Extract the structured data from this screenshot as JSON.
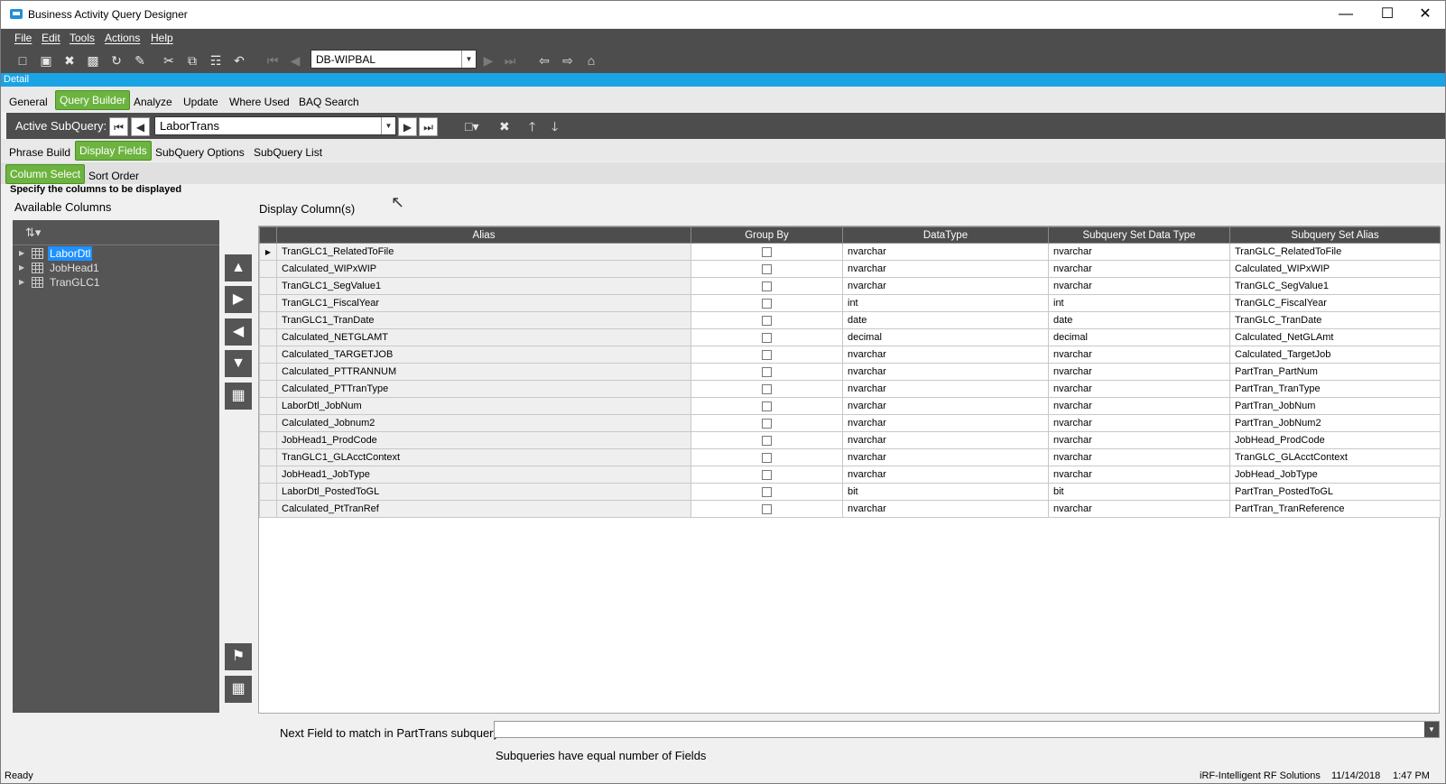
{
  "window": {
    "title": "Business Activity Query Designer"
  },
  "menu": [
    "File",
    "Edit",
    "Tools",
    "Actions",
    "Help"
  ],
  "toolbar": {
    "query_id": "DB-WIPBAL"
  },
  "detail_label": "Detail",
  "main_tabs": [
    "General",
    "Query Builder",
    "Analyze",
    "Update",
    "Where Used",
    "BAQ Search"
  ],
  "subquery": {
    "label": "Active SubQuery:",
    "value": "LaborTrans"
  },
  "sub_tabs": [
    "Phrase Build",
    "Display Fields",
    "SubQuery Options",
    "SubQuery List"
  ],
  "inner_tabs": [
    "Column Select",
    "Sort Order"
  ],
  "hint": "Specify the columns to be displayed",
  "available_label": "Available Columns",
  "display_label": "Display Column(s)",
  "tree": [
    "LaborDtl",
    "JobHead1",
    "TranGLC1"
  ],
  "grid": {
    "columns": [
      "Alias",
      "Group By",
      "DataType",
      "Subquery Set Data Type",
      "Subquery Set Alias"
    ],
    "rows": [
      [
        "TranGLC1_RelatedToFile",
        "nvarchar",
        "nvarchar",
        "TranGLC_RelatedToFile"
      ],
      [
        "Calculated_WIPxWIP",
        "nvarchar",
        "nvarchar",
        "Calculated_WIPxWIP"
      ],
      [
        "TranGLC1_SegValue1",
        "nvarchar",
        "nvarchar",
        "TranGLC_SegValue1"
      ],
      [
        "TranGLC1_FiscalYear",
        "int",
        "int",
        "TranGLC_FiscalYear"
      ],
      [
        "TranGLC1_TranDate",
        "date",
        "date",
        "TranGLC_TranDate"
      ],
      [
        "Calculated_NETGLAMT",
        "decimal",
        "decimal",
        "Calculated_NetGLAmt"
      ],
      [
        "Calculated_TARGETJOB",
        "nvarchar",
        "nvarchar",
        "Calculated_TargetJob"
      ],
      [
        "Calculated_PTTRANNUM",
        "nvarchar",
        "nvarchar",
        "PartTran_PartNum"
      ],
      [
        "Calculated_PTTranType",
        "nvarchar",
        "nvarchar",
        "PartTran_TranType"
      ],
      [
        "LaborDtl_JobNum",
        "nvarchar",
        "nvarchar",
        "PartTran_JobNum"
      ],
      [
        "Calculated_Jobnum2",
        "nvarchar",
        "nvarchar",
        "PartTran_JobNum2"
      ],
      [
        "JobHead1_ProdCode",
        "nvarchar",
        "nvarchar",
        "JobHead_ProdCode"
      ],
      [
        "TranGLC1_GLAcctContext",
        "nvarchar",
        "nvarchar",
        "TranGLC_GLAcctContext"
      ],
      [
        "JobHead1_JobType",
        "nvarchar",
        "nvarchar",
        "JobHead_JobType"
      ],
      [
        "LaborDtl_PostedToGL",
        "bit",
        "bit",
        "PartTran_PostedToGL"
      ],
      [
        "Calculated_PtTranRef",
        "nvarchar",
        "nvarchar",
        "PartTran_TranReference"
      ]
    ]
  },
  "next_field_label": "Next Field to match in PartTrans subquery:",
  "equal_msg": "Subqueries have equal number of Fields",
  "status": {
    "left": "Ready",
    "company": "iRF-Intelligent RF Solutions",
    "date": "11/14/2018",
    "time": "1:47 PM"
  }
}
